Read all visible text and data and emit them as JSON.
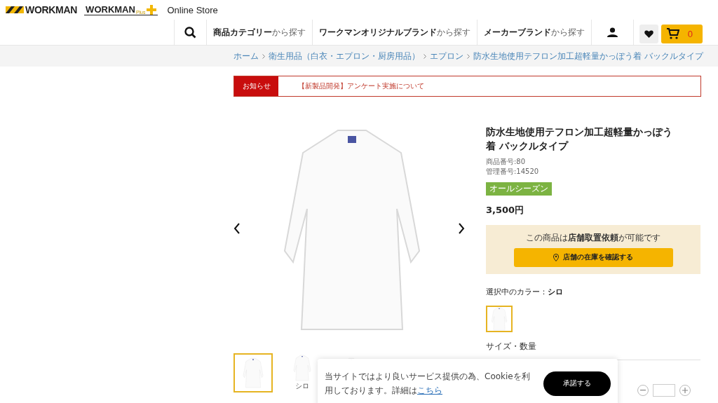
{
  "header": {
    "logo": "WORKMAN",
    "plus_logo": "WORKMAN",
    "plus_suffix": "Plus",
    "store_label": "Online Store"
  },
  "nav": {
    "items": [
      {
        "bold": "商品カテゴリー",
        "rest": "から探す"
      },
      {
        "bold": "ワークマンオリジナルブランド",
        "rest": "から探す"
      },
      {
        "bold": "メーカーブランド",
        "rest": "から探す"
      }
    ],
    "cart_count": "0"
  },
  "breadcrumb": [
    "ホーム",
    "衛生用品（白衣・エプロン・厨房用品）",
    "エプロン",
    "防水生地使用テフロン加工超軽量かっぽう着 バックルタイプ"
  ],
  "notice": {
    "label": "お知らせ",
    "text": "【新製品開発】アンケート実施について"
  },
  "gallery": {
    "thumbnails": [
      {
        "selected": true
      },
      {
        "selected": false,
        "caption": "シロ"
      },
      {
        "selected": false
      }
    ]
  },
  "product": {
    "title": "防水生地使用テフロン加工超軽量かっぽう着 バックルタイプ",
    "product_no": "商品番号:80",
    "control_no": "管理番号:14520",
    "tag": "オールシーズン",
    "price": "3,500円",
    "store_notice": "この商品は**店舗取置依頼**が可能です",
    "store_button": "店舗の在庫を確認する",
    "color_label": "選択中のカラー：**シロ**",
    "swatches": [
      {
        "selected": true
      }
    ],
    "size_heading": "サイズ・数量"
  },
  "cookie": {
    "text": "当サイトではより良いサービス提供の為、Cookieを利用しております。詳細は",
    "link": "こちら",
    "button": "承諾する"
  }
}
